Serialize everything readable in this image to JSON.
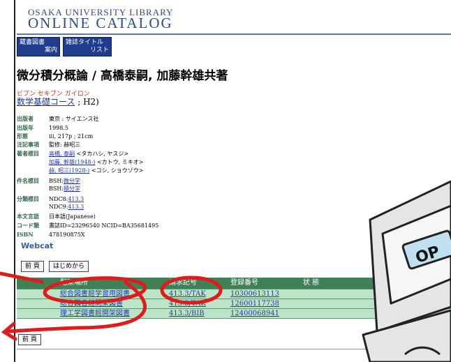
{
  "header": {
    "top_title": "OSAKA UNIVERSITY LIBRARY",
    "main_title": "ONLINE CATALOG"
  },
  "nav": [
    {
      "line1": "蔵書図書",
      "line2": "案内"
    },
    {
      "line1": "雑誌タイトル",
      "line2": "リスト"
    }
  ],
  "record": {
    "title": "微分積分概論 / 高橋泰嗣, 加藤幹雄共著",
    "title_kana": "ビブン セキブン ガイロン",
    "series_link": "数学基礎コース",
    "series_suffix": " ; H2)",
    "fields": [
      {
        "label": "出版者",
        "value": "東京 : サイエンス社"
      },
      {
        "label": "出版年",
        "value": "1998.5"
      },
      {
        "label": "形態",
        "value": "iii, 217p ; 21cm"
      },
      {
        "label": "注記事項",
        "value": "監修: 赫昭三"
      },
      {
        "label": "著者標目",
        "link": "高橋, 泰嗣",
        "value": " <タカハシ, ヤスジ>"
      },
      {
        "label": "",
        "link": "加藤, 幹雄(1948-)",
        "value": " <カトウ, ミキオ>"
      },
      {
        "label": "",
        "link": "赫, 昭三(1928-)",
        "value": " <コシ, ショウゾウ>"
      },
      {
        "label": "件名標目",
        "prefix": "BSH:",
        "link": "微分学"
      },
      {
        "label": "",
        "prefix": "BSH:",
        "link": "積分学"
      },
      {
        "label": "分類標目",
        "prefix": "NDC8:",
        "link": "413.3"
      },
      {
        "label": "",
        "prefix": "NDC9:",
        "link": "413.3"
      },
      {
        "label": "本文言語",
        "value": "日本語(Japanese)"
      },
      {
        "label": "コード類",
        "value": "書誌ID=23296540 NCID=BA35681495"
      },
      {
        "label": "ISBN",
        "value": "478190875X"
      }
    ],
    "webcat": "Webcat"
  },
  "buttons": {
    "prev": "前 頁",
    "first": "はじめから",
    "prev_bottom": "前 頁"
  },
  "holdings": {
    "headers": [
      "配架場所",
      "請求記号",
      "登録番号",
      "状 態"
    ],
    "rows": [
      [
        "総合図書館学習用図書",
        "413.3/TAK",
        "10300613113",
        ""
      ],
      [
        "総合図書館開架図書",
        "413.3/TAK",
        "12600117738",
        ""
      ],
      [
        "理工学図書館開架図書",
        "413.3/BIB",
        "12400068941",
        ""
      ]
    ]
  },
  "sticker": {
    "label": "OP"
  },
  "colors": {
    "nav_bg": "#1f3c8f",
    "table_header": "#3f8055",
    "table_row": "#bde3c8",
    "annotation_red": "#e01b1b",
    "link": "#1f3ab0"
  }
}
